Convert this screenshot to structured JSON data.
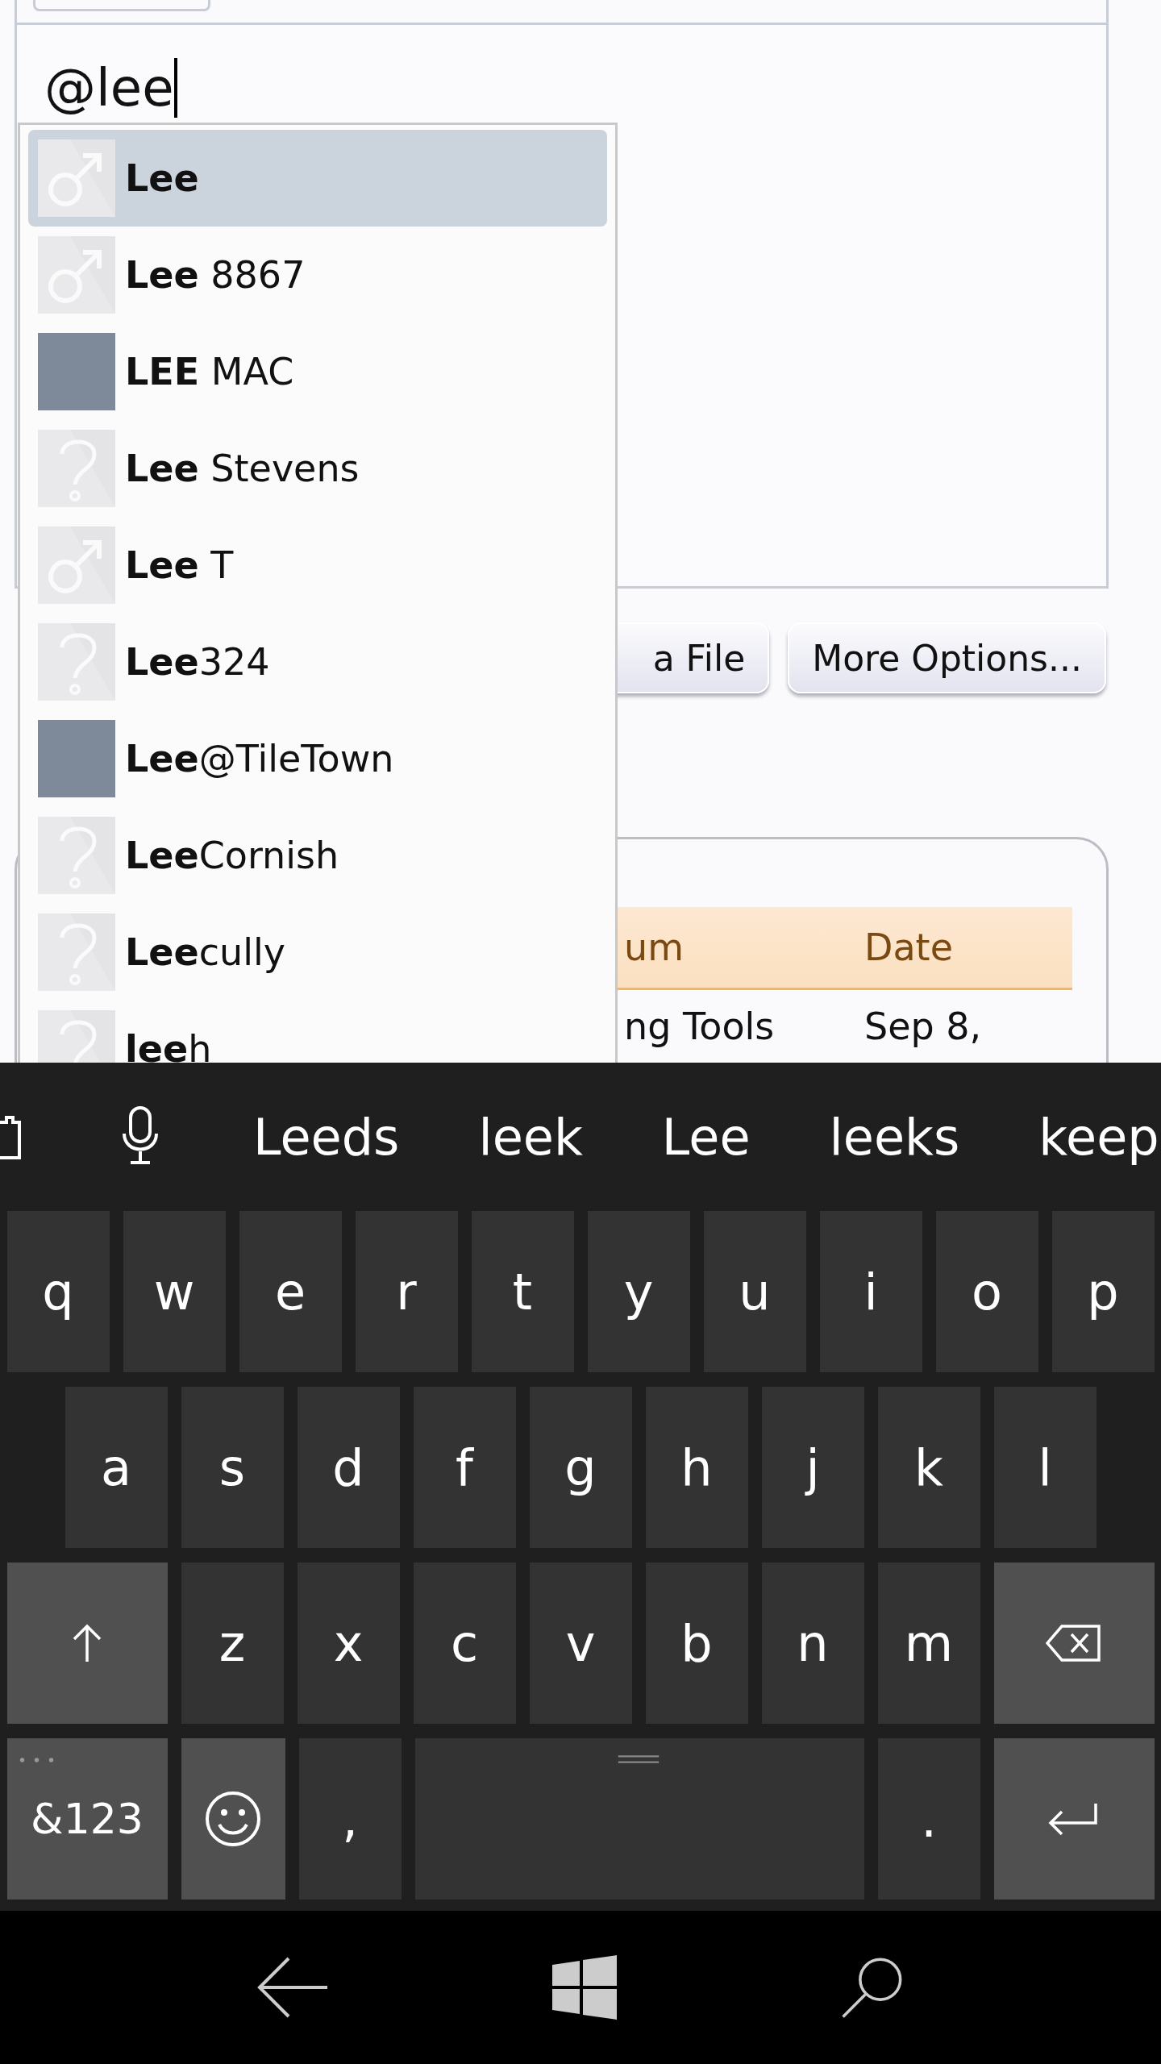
{
  "editor": {
    "value": "@lee"
  },
  "mention_suggestions": [
    {
      "label": "**Lee**",
      "kind": "male",
      "selected": true
    },
    {
      "label": "**Lee** 8867",
      "kind": "male",
      "selected": false
    },
    {
      "label": "**LEE** MAC",
      "kind": "photo",
      "selected": false
    },
    {
      "label": "**Lee** Stevens",
      "kind": "unknown",
      "selected": false
    },
    {
      "label": "**Lee** T",
      "kind": "male",
      "selected": false
    },
    {
      "label": "**Lee**324",
      "kind": "unknown",
      "selected": false
    },
    {
      "label": "**Lee**@TileTown",
      "kind": "photo",
      "selected": false
    },
    {
      "label": "**Lee**Cornish",
      "kind": "unknown",
      "selected": false
    },
    {
      "label": "**Lee**cully",
      "kind": "unknown",
      "selected": false
    },
    {
      "label": "**lee**h",
      "kind": "unknown",
      "selected": false
    }
  ],
  "buttons": [
    "a File",
    "More Options..."
  ],
  "table": {
    "columns": [
      "um",
      "Date"
    ],
    "rows": [
      [
        "ng Tools",
        "Sep 8,"
      ]
    ]
  },
  "keyboard": {
    "suggestions": [
      "Leeds",
      "leek",
      "Lee",
      "leeks",
      "keep"
    ],
    "rows": [
      {
        "keys": [
          {
            "kind": "char",
            "label": "q"
          },
          {
            "kind": "char",
            "label": "w"
          },
          {
            "kind": "char",
            "label": "e"
          },
          {
            "kind": "char",
            "label": "r"
          },
          {
            "kind": "char",
            "label": "t"
          },
          {
            "kind": "char",
            "label": "y"
          },
          {
            "kind": "char",
            "label": "u"
          },
          {
            "kind": "char",
            "label": "i"
          },
          {
            "kind": "char",
            "label": "o"
          },
          {
            "kind": "char",
            "label": "p"
          }
        ]
      },
      {
        "keys": [
          {
            "kind": "char",
            "label": "a"
          },
          {
            "kind": "char",
            "label": "s"
          },
          {
            "kind": "char",
            "label": "d"
          },
          {
            "kind": "char",
            "label": "f"
          },
          {
            "kind": "char",
            "label": "g"
          },
          {
            "kind": "char",
            "label": "h"
          },
          {
            "kind": "char",
            "label": "j"
          },
          {
            "kind": "char",
            "label": "k"
          },
          {
            "kind": "char",
            "label": "l"
          }
        ]
      },
      {
        "keys": [
          {
            "kind": "shift"
          },
          {
            "kind": "char",
            "label": "z"
          },
          {
            "kind": "char",
            "label": "x"
          },
          {
            "kind": "char",
            "label": "c"
          },
          {
            "kind": "char",
            "label": "v"
          },
          {
            "kind": "char",
            "label": "b"
          },
          {
            "kind": "char",
            "label": "n"
          },
          {
            "kind": "char",
            "label": "m"
          },
          {
            "kind": "backspace"
          }
        ]
      },
      {
        "keys": [
          {
            "kind": "symbols",
            "label": "&123"
          },
          {
            "kind": "emoji"
          },
          {
            "kind": "char",
            "label": ","
          },
          {
            "kind": "space"
          },
          {
            "kind": "char",
            "label": "."
          },
          {
            "kind": "enter"
          }
        ]
      }
    ]
  }
}
